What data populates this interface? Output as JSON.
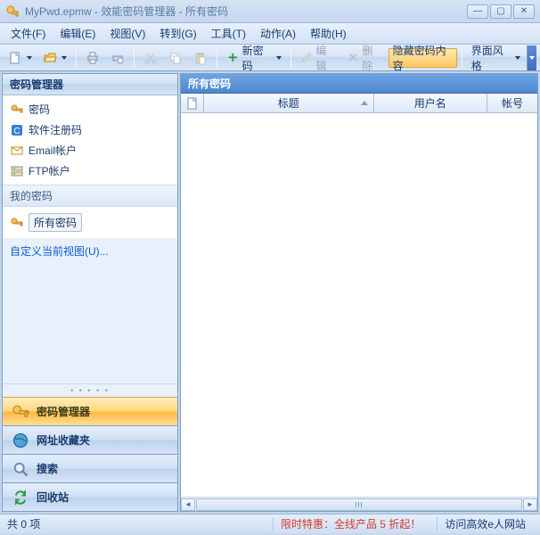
{
  "window": {
    "title": "MyPwd.epmw - 效能密码管理器 - 所有密码",
    "min": "—",
    "max": "▢",
    "close": "✕"
  },
  "menu": {
    "file": "文件(F)",
    "edit": "编辑(E)",
    "view": "视图(V)",
    "goto": "转到(G)",
    "tools": "工具(T)",
    "action": "动作(A)",
    "help": "帮助(H)"
  },
  "toolbar": {
    "new_password": "新密码",
    "edit": "编辑",
    "delete": "删除",
    "hide_content": "隐藏密码内容",
    "ui_style": "界面风格"
  },
  "sidebar": {
    "header": "密码管理器",
    "items": [
      {
        "label": "密码"
      },
      {
        "label": "软件注册码"
      },
      {
        "label": "Email帐户"
      },
      {
        "label": "FTP帐户"
      }
    ],
    "my_header": "我的密码",
    "all_passwords": "所有密码",
    "customize": "自定义当前视图(U)...",
    "nav": {
      "manager": "密码管理器",
      "favorites": "网址收藏夹",
      "search": "搜索",
      "recycle": "回收站"
    }
  },
  "content": {
    "header": "所有密码",
    "cols": {
      "icon": "",
      "title": "标题",
      "user": "用户名",
      "account": "帐号"
    }
  },
  "status": {
    "count": "共 0 项",
    "promo": "限时特惠：全线产品 5 折起！",
    "site": "访问高效e人网站"
  },
  "colors": {
    "accent_orange": "#ffb843",
    "blue_header": "#4f86cf"
  }
}
